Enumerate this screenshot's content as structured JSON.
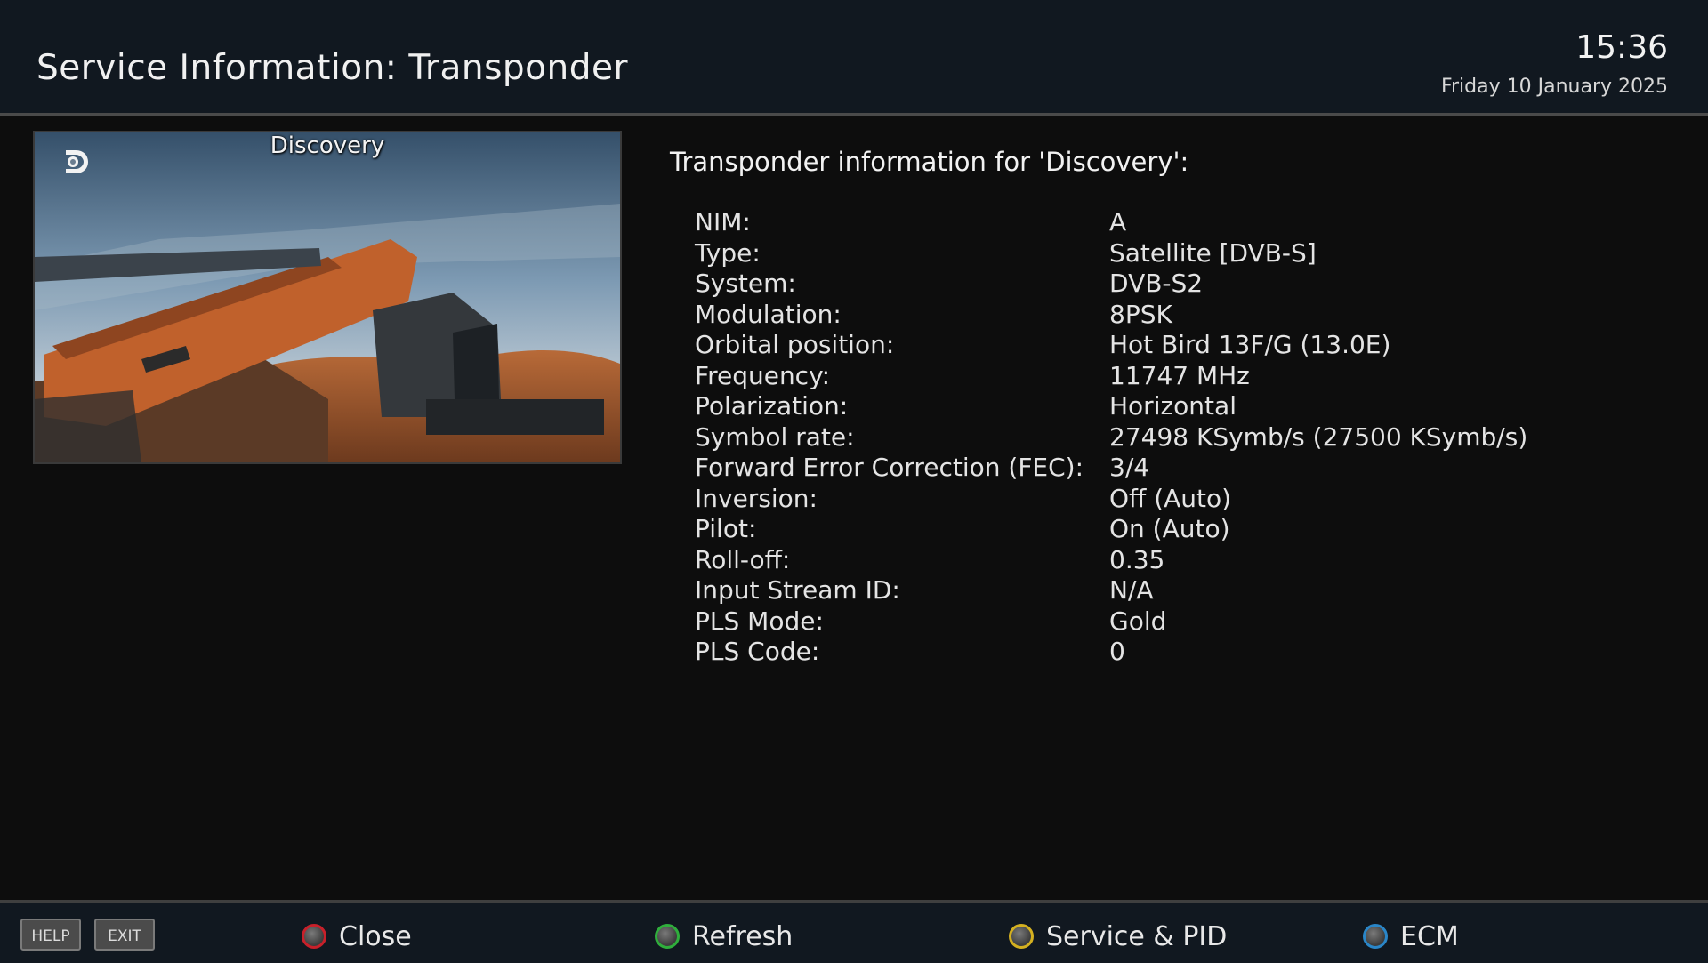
{
  "header": {
    "title": "Service Information: Transponder",
    "clock": "15:36",
    "date": "Friday 10 January 2025"
  },
  "preview": {
    "channel_name": "Discovery",
    "logo_icon": "discovery-logo-icon"
  },
  "info": {
    "heading": "Transponder information for 'Discovery':",
    "rows": [
      {
        "label": "NIM:",
        "value": "A"
      },
      {
        "label": "Type:",
        "value": "Satellite  [DVB-S]"
      },
      {
        "label": "System:",
        "value": "DVB-S2"
      },
      {
        "label": "Modulation:",
        "value": "8PSK"
      },
      {
        "label": "Orbital position:",
        "value": "Hot Bird 13F/G (13.0E)"
      },
      {
        "label": "Frequency:",
        "value": "11747 MHz"
      },
      {
        "label": "Polarization:",
        "value": "Horizontal"
      },
      {
        "label": "Symbol rate:",
        "value": "27498 KSymb/s  (27500 KSymb/s)"
      },
      {
        "label": "Forward Error Correction (FEC):",
        "value": "3/4"
      },
      {
        "label": "Inversion:",
        "value": "Off  (Auto)"
      },
      {
        "label": "Pilot:",
        "value": "On  (Auto)"
      },
      {
        "label": "Roll-off:",
        "value": "0.35"
      },
      {
        "label": "Input Stream ID:",
        "value": "N/A"
      },
      {
        "label": "PLS Mode:",
        "value": "Gold"
      },
      {
        "label": "PLS Code:",
        "value": "0"
      }
    ]
  },
  "footer": {
    "help_key": "HELP",
    "exit_key": "EXIT",
    "buttons": [
      {
        "label": "Close",
        "color": "#c8202a",
        "icon": "red-button-icon"
      },
      {
        "label": "Refresh",
        "color": "#2fae3c",
        "icon": "green-button-icon"
      },
      {
        "label": "Service & PID",
        "color": "#d4b020",
        "icon": "yellow-button-icon"
      },
      {
        "label": "ECM",
        "color": "#2a86c8",
        "icon": "blue-button-icon"
      }
    ]
  }
}
